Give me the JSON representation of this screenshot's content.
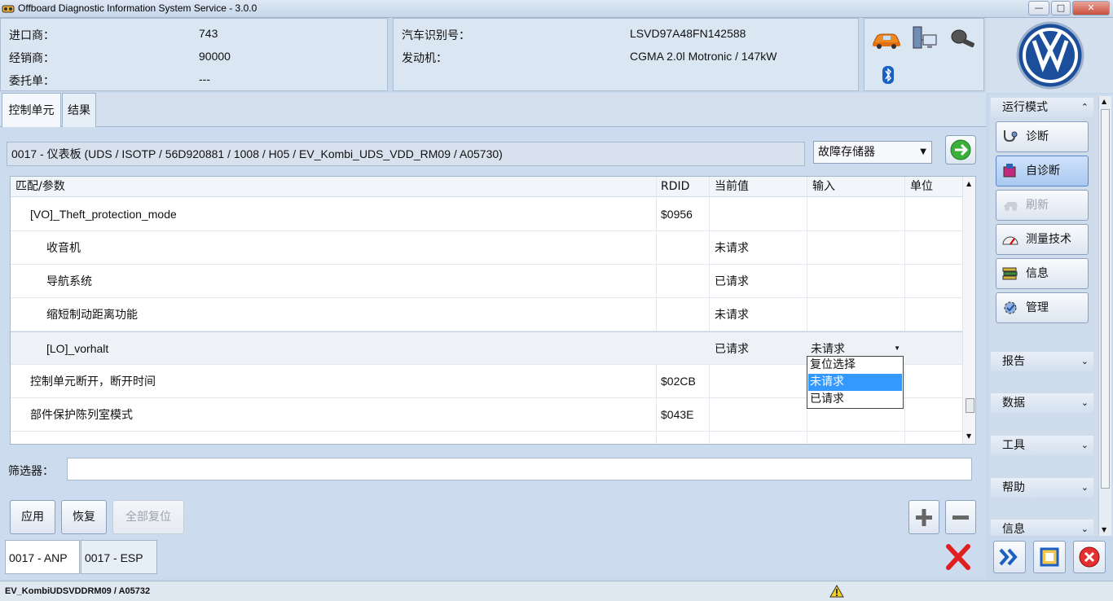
{
  "window": {
    "title": "Offboard Diagnostic Information System Service - 3.0.0",
    "controls": [
      "—",
      "□",
      "✕"
    ]
  },
  "header": {
    "left": [
      {
        "label": "进口商：",
        "value": "743"
      },
      {
        "label": "经销商：",
        "value": "90000"
      },
      {
        "label": "委托单：",
        "value": "---"
      }
    ],
    "right": [
      {
        "label": "汽车识别号：",
        "value": "LSVD97A48FN142588"
      },
      {
        "label": "发动机：",
        "value": "CGMA 2.0l Motronic / 147kW"
      }
    ],
    "status_icons": [
      "car-icon",
      "network-icon",
      "key-icon",
      "bluetooth-icon"
    ],
    "logo": "VW"
  },
  "tabs": [
    {
      "label": "控制单元",
      "active": true
    },
    {
      "label": "结果",
      "active": false
    }
  ],
  "module": {
    "description": "0017 - 仪表板  (UDS / ISOTP / 56D920881   / 1008 / H05 / EV_Kombi_UDS_VDD_RM09 / A05730)",
    "selector_value": "故障存储器"
  },
  "table": {
    "columns": [
      "匹配/参数",
      "RDID",
      "当前值",
      "输入",
      "单位"
    ],
    "rows": [
      {
        "param": "[VO]_Theft_protection_mode",
        "rdid": "$0956",
        "current": "",
        "input": "",
        "unit": "",
        "level": 1
      },
      {
        "param": "收音机",
        "rdid": "",
        "current": "未请求",
        "input": "",
        "unit": "",
        "level": 2
      },
      {
        "param": "导航系统",
        "rdid": "",
        "current": "已请求",
        "input": "",
        "unit": "",
        "level": 2
      },
      {
        "param": "缩短制动距离功能",
        "rdid": "",
        "current": "未请求",
        "input": "",
        "unit": "",
        "level": 2
      },
      {
        "param": "[LO]_vorhalt",
        "rdid": "",
        "current": "已请求",
        "input": "未请求",
        "unit": "",
        "level": 2,
        "selected": true
      },
      {
        "param": "控制单元断开，断开时间",
        "rdid": "$02CB",
        "current": "",
        "input": "",
        "unit": "",
        "level": 1
      },
      {
        "param": "部件保护陈列室模式",
        "rdid": "$043E",
        "current": "",
        "input": "",
        "unit": "",
        "level": 1
      }
    ],
    "dropdown": {
      "options": [
        "复位选择",
        "未请求",
        "已请求"
      ],
      "highlighted": "未请求"
    }
  },
  "filter": {
    "label": "筛选器：",
    "value": ""
  },
  "actions": {
    "apply": "应用",
    "restore": "恢复",
    "reset_all": "全部复位"
  },
  "bottom_tabs": [
    "0017 - ANP",
    "0017 - ESP"
  ],
  "statusbar": {
    "text": "EV_KombiUDSVDDRM09 / A05732"
  },
  "sidebar": {
    "mode_header": "运行模式",
    "buttons": [
      {
        "label": "诊断",
        "icon": "stethoscope-icon",
        "state": "normal"
      },
      {
        "label": "自诊断",
        "icon": "self-diagnosis-icon",
        "state": "active"
      },
      {
        "label": "刷新",
        "icon": "flash-icon",
        "state": "disabled"
      },
      {
        "label": "测量技术",
        "icon": "gauge-icon",
        "state": "normal"
      },
      {
        "label": "信息",
        "icon": "books-icon",
        "state": "normal"
      },
      {
        "label": "管理",
        "icon": "gear-check-icon",
        "state": "normal"
      }
    ],
    "sections": [
      "报告",
      "数据",
      "工具",
      "帮助",
      "信息"
    ]
  },
  "colors": {
    "accent": "#3399ff",
    "active_sidebar": "#a9c9f1",
    "background": "#c8d8ec"
  }
}
